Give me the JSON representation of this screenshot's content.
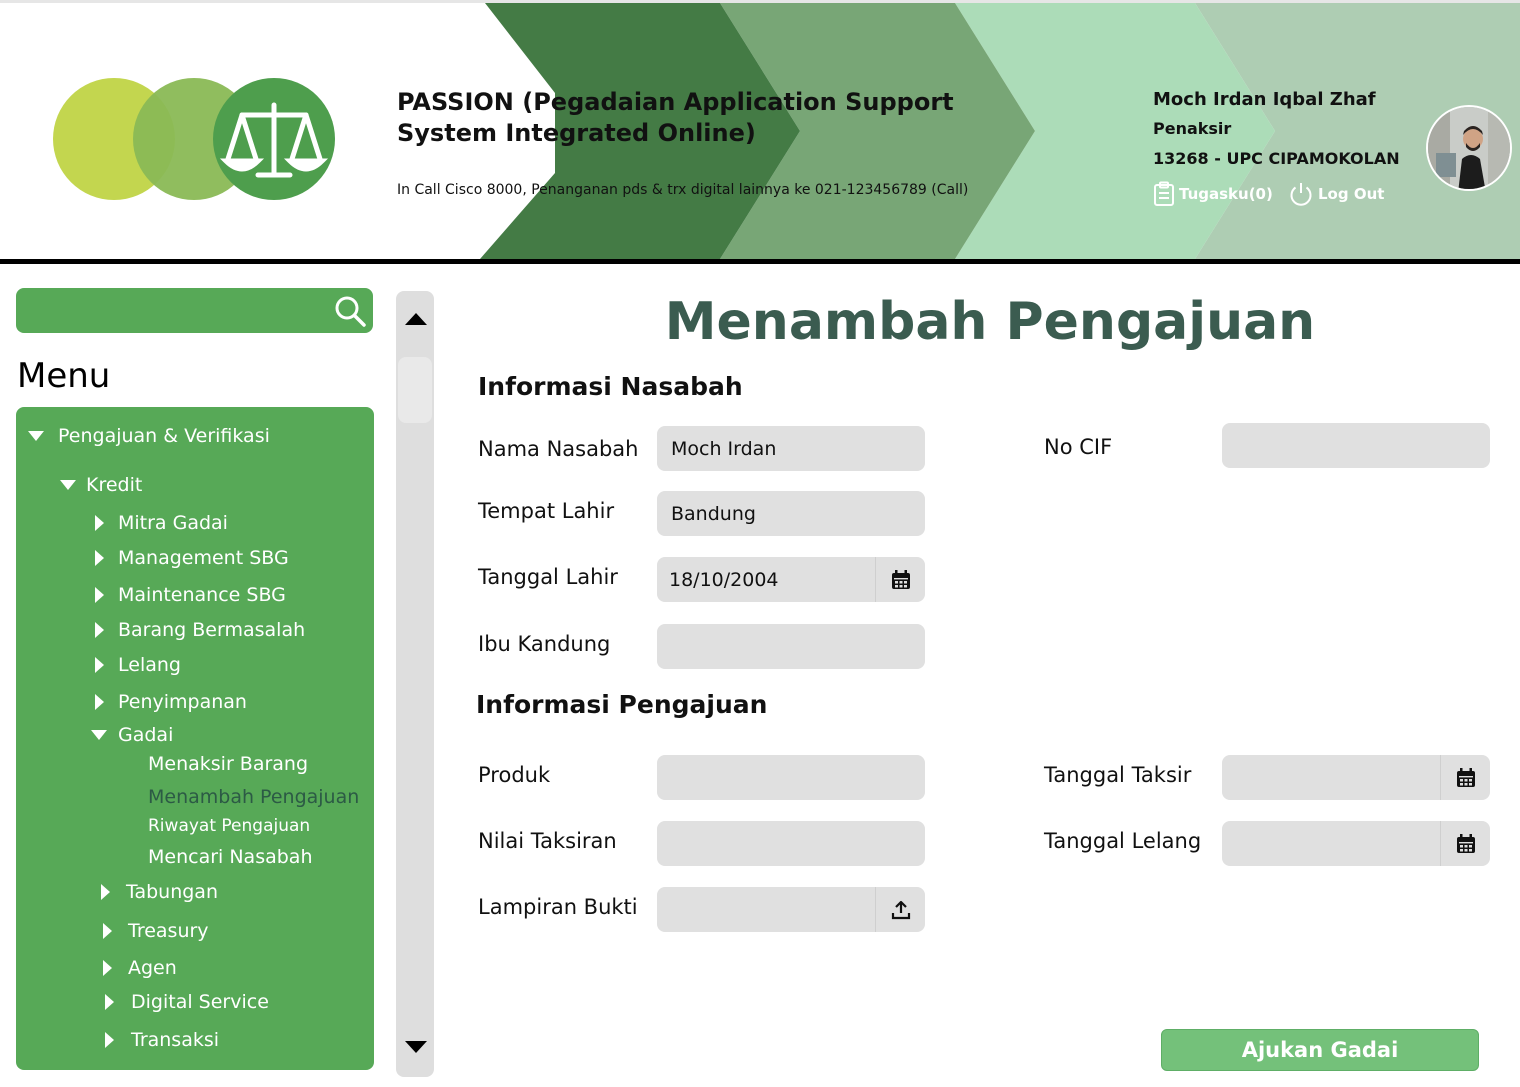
{
  "header": {
    "title": "PASSION (Pegadaian Application Support System Integrated Online)",
    "subtitle": "In Call Cisco 8000, Penanganan pds & trx digital lainnya ke 021-123456789 (Call)",
    "user_name": "Moch Irdan Iqbal Zhaf",
    "user_role": "Penaksir",
    "user_branch": "13268 - UPC CIPAMOKOLAN",
    "task_label": "Tugasku(0)",
    "logout_label": "Log Out"
  },
  "sidebar": {
    "search_placeholder": "",
    "menu_title": "Menu",
    "items": [
      {
        "label": "Pengajuan & Verifikasi"
      },
      {
        "label": "Kredit"
      },
      {
        "label": "Mitra Gadai"
      },
      {
        "label": "Management SBG"
      },
      {
        "label": "Maintenance SBG"
      },
      {
        "label": "Barang Bermasalah"
      },
      {
        "label": "Lelang"
      },
      {
        "label": "Penyimpanan"
      },
      {
        "label": "Gadai"
      },
      {
        "label": "Menaksir Barang"
      },
      {
        "label": "Menambah Pengajuan"
      },
      {
        "label": "Riwayat Pengajuan"
      },
      {
        "label": "Mencari Nasabah"
      },
      {
        "label": "Tabungan"
      },
      {
        "label": "Treasury"
      },
      {
        "label": "Agen"
      },
      {
        "label": "Digital Service"
      },
      {
        "label": "Transaksi"
      }
    ]
  },
  "main": {
    "title": "Menambah Pengajuan",
    "section_nasabah": "Informasi Nasabah",
    "section_pengajuan": "Informasi Pengajuan",
    "fields": {
      "nama_nasabah": {
        "label": "Nama Nasabah",
        "value": "Moch Irdan"
      },
      "no_cif": {
        "label": "No CIF",
        "value": ""
      },
      "tempat_lahir": {
        "label": "Tempat Lahir",
        "value": "Bandung"
      },
      "tanggal_lahir": {
        "label": "Tanggal Lahir",
        "value": "18/10/2004"
      },
      "ibu_kandung": {
        "label": "Ibu Kandung",
        "value": ""
      },
      "produk": {
        "label": "Produk",
        "value": ""
      },
      "tanggal_taksir": {
        "label": "Tanggal Taksir",
        "value": ""
      },
      "nilai_taksiran": {
        "label": "Nilai Taksiran",
        "value": ""
      },
      "tanggal_lelang": {
        "label": "Tanggal Lelang",
        "value": ""
      },
      "lampiran_bukti": {
        "label": "Lampiran Bukti",
        "value": ""
      }
    },
    "submit_label": "Ajukan Gadai"
  },
  "colors": {
    "sidebar_green": "#57a957",
    "title_green": "#3b5c50",
    "button_green": "#74c17a",
    "field_grey": "#e0e0e0"
  },
  "icons": {
    "search": "search-icon",
    "calendar": "calendar-icon",
    "upload": "upload-icon",
    "task": "clipboard-icon",
    "logout": "power-icon",
    "logo": "scales-icon"
  }
}
